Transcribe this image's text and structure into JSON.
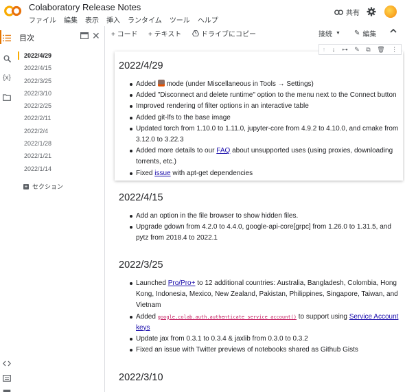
{
  "app": {
    "title": "Colaboratory Release Notes",
    "logo_text": "CO",
    "share_label": "共有",
    "brand_color": "#f9ab00"
  },
  "menu": [
    "ファイル",
    "編集",
    "表示",
    "挿入",
    "ランタイム",
    "ツール",
    "ヘルプ"
  ],
  "toolbar": {
    "add_code": "+ コード",
    "add_text": "+ テキスト",
    "copy_to_drive": "ドライブにコピー",
    "connect": "接続",
    "edit": "編集"
  },
  "rail": {
    "icons": [
      "toc-icon",
      "search-icon",
      "variables-icon",
      "folder-icon",
      "code-snippets-icon",
      "terminal-icon"
    ],
    "variables_glyph": "{x}"
  },
  "toc": {
    "title": "目次",
    "items": [
      "2022/4/29",
      "2022/4/15",
      "2022/3/25",
      "2022/3/10",
      "2022/2/25",
      "2022/2/11",
      "2022/2/4",
      "2022/1/28",
      "2022/1/21",
      "2022/1/14"
    ],
    "section_label": "セクション"
  },
  "cells": [
    {
      "heading": "2022/4/29",
      "items": [
        {
          "before": "Added ",
          "after": " mode (under Miscellaneous in Tools → Settings)"
        },
        {
          "text": "Added \"Disconnect and delete runtime\" option to the menu next to the Connect button"
        },
        {
          "text": "Improved rendering of filter options in an interactive table"
        },
        {
          "text": "Added git-lfs to the base image"
        },
        {
          "text": "Updated torch from 1.10.0 to 1.11.0, jupyter-core from 4.9.2 to 4.10.0, and cmake from 3.12.0 to 3.22.3"
        },
        {
          "before": "Added more details to our ",
          "link": "FAQ",
          "after": " about unsupported uses (using proxies, downloading torrents, etc.)"
        },
        {
          "before": "Fixed ",
          "link": "issue",
          "after": " with apt-get dependencies"
        }
      ]
    },
    {
      "heading": "2022/4/15",
      "items": [
        {
          "text": "Add an option in the file browser to show hidden files."
        },
        {
          "text": "Upgrade gdown from 4.2.0 to 4.4.0, google-api-core[grpc] from 1.26.0 to 1.31.5, and pytz from 2018.4 to 2022.1"
        }
      ]
    },
    {
      "heading": "2022/3/25",
      "items": [
        {
          "before": "Launched ",
          "link": "Pro/Pro+",
          "after": " to 12 additional countries: Australia, Bangladesh, Colombia, Hong Kong, Indonesia, Mexico, New Zealand, Pakistan, Philippines, Singapore, Taiwan, and Vietnam"
        },
        {
          "before": "Added ",
          "code": "google.colab.auth.authenticate_service_account()",
          "middle": " to support using ",
          "link": "Service Account keys"
        },
        {
          "text": "Update jax from 0.3.1 to 0.3.4 & jaxlib from 0.3.0 to 0.3.2"
        },
        {
          "text": "Fixed an issue with Twitter previews of notebooks shared as Github Gists"
        }
      ]
    },
    {
      "heading": "2022/3/10",
      "items": []
    }
  ]
}
